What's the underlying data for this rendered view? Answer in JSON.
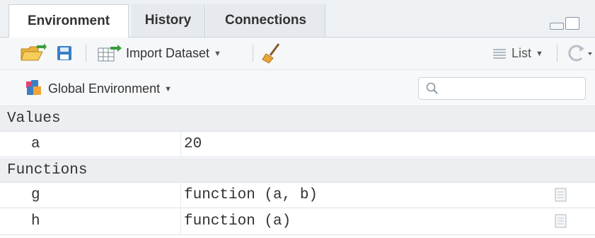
{
  "tabs": [
    {
      "label": "Environment",
      "active": true
    },
    {
      "label": "History",
      "active": false
    },
    {
      "label": "Connections",
      "active": false
    }
  ],
  "toolbar": {
    "import_label": "Import Dataset",
    "view_label": "List",
    "icons": [
      "open-folder-icon",
      "save-icon",
      "import-dataset-icon",
      "broom-icon",
      "list-view-icon",
      "refresh-icon"
    ]
  },
  "env_selector": {
    "label": "Global Environment",
    "search_value": ""
  },
  "table": {
    "sections": [
      {
        "title": "Values",
        "rows": [
          {
            "name": "a",
            "value": "20"
          }
        ]
      },
      {
        "title": "Functions",
        "rows": [
          {
            "name": "g",
            "value": "function (a, b)"
          },
          {
            "name": "h",
            "value": "function (a)"
          }
        ]
      }
    ]
  },
  "colors": {
    "tabbar_bg": "#eef1f4",
    "section_bg": "#eceef2",
    "accent_blue": "#3a7fc4"
  }
}
